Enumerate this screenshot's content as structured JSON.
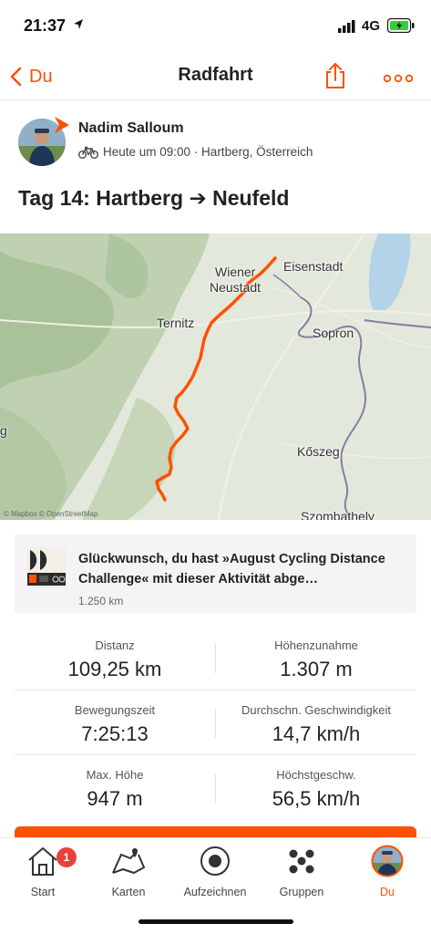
{
  "status_bar": {
    "time": "21:37",
    "network": "4G",
    "icons": [
      "location-arrow-icon",
      "signal-icon",
      "battery-icon"
    ]
  },
  "nav": {
    "back_label": "Du",
    "title": "Radfahrt",
    "icons": [
      "chevron-left-icon",
      "share-icon",
      "more-icon"
    ]
  },
  "athlete": {
    "name": "Nadim Salloum",
    "meta": "Heute um 09:00 · Hartberg, Österreich",
    "sport_icon": "bike-icon"
  },
  "activity": {
    "title": "Tag 14: Hartberg ➔ Neufeld"
  },
  "map": {
    "labels": {
      "eisenstadt": "Eisenstadt",
      "wiener": "Wiener",
      "neustadt": "Neustadt",
      "ternitz": "Ternitz",
      "sopron": "Sopron",
      "koszeg": "Kőszeg",
      "szombathely": "Szombathely",
      "g": "g"
    },
    "attribution": "© Mapbox © OpenStreetMap",
    "route_color": "#fc5200"
  },
  "achievement": {
    "text": "Glückwunsch, du hast »August Cycling Distance Challenge« mit dieser Aktivität abge…",
    "sub": "1.250 km"
  },
  "stats": {
    "distance": {
      "label": "Distanz",
      "value": "109,25 km"
    },
    "elevation_gain": {
      "label": "Höhenzunahme",
      "value": "1.307 m"
    },
    "moving_time": {
      "label": "Bewegungszeit",
      "value": "7:25:13"
    },
    "avg_speed": {
      "label": "Durchschn. Geschwindigkeit",
      "value": "14,7 km/h"
    },
    "max_elevation": {
      "label": "Max. Höhe",
      "value": "947 m"
    },
    "max_speed": {
      "label": "Höchstgeschw.",
      "value": "56,5 km/h"
    }
  },
  "tabs": {
    "start": {
      "label": "Start",
      "badge": "1"
    },
    "maps": {
      "label": "Karten"
    },
    "record": {
      "label": "Aufzeichnen"
    },
    "groups": {
      "label": "Gruppen"
    },
    "you": {
      "label": "Du"
    }
  },
  "colors": {
    "accent": "#fc5200",
    "badge_red": "#e8413a"
  }
}
